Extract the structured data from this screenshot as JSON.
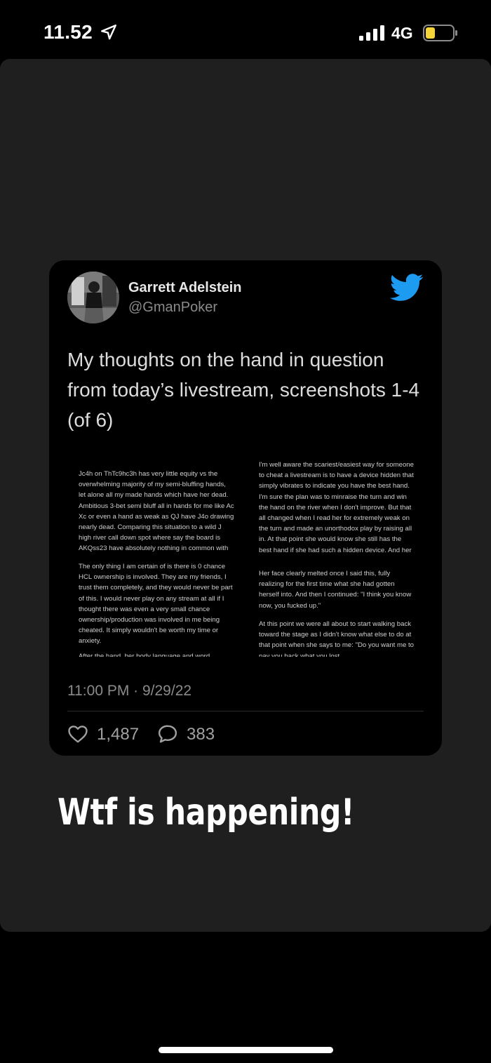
{
  "status_bar": {
    "time": "11.52",
    "network": "4G",
    "icons": [
      "location-arrow-icon",
      "signal-bars-icon",
      "battery-icon"
    ],
    "battery_color": "#f5d33a"
  },
  "tweet": {
    "author_name": "Garrett Adelstein",
    "author_handle": "@GmanPoker",
    "text": "My thoughts on the hand in question from today’s livestream, screenshots 1-4 (of 6)",
    "timestamp": "11:00 PM · 9/29/22",
    "likes": "1,487",
    "replies": "383",
    "brand_color": "#1d9bf0",
    "screenshots": {
      "left": [
        "Jc4h on ThTc9hc3h has very little equity vs the overwhelming majority of my semi-bluffing hands, let alone all my made hands which have her dead. Ambitious 3-bet semi bluff all in hands for me like Ac Xc or even a hand as weak as QJ have J4o drawing nearly dead. Comparing this situation to a wild J high river call down spot where say the board is AKQss23 have absolutely nothing in common with this",
        "The only thing I am certain of is there is 0 chance HCL ownership is involved. They are my friends, I trust them completely, and they would never be part of this. I would never play on any stream at all if I thought there was even a very small chance ownership/production was involved in me being cheated. It simply wouldn't be worth my time or anxiety.",
        "After the hand, her body language and word"
      ],
      "right": [
        "I'm well aware the scariest/easiest way for someone to cheat a livestream is to have a device hidden that simply vibrates to indicate you have the best hand. I'm sure the plan was to minraise the turn and win the hand on the river when I don't improve. But that all changed when I read her for extremely weak on the turn and made an unorthodox play by raising all in. At that point she would know she still has the best hand if she had such a hidden device. And her",
        "Her face clearly melted once I said this, fully realizing for the first time what she had gotten herself into. And then I continued: \"I think you know now, you fucked up.\"",
        "At this point we were all about to start walking back toward the stage as I didn't know what else to do at that point when she says to me: \"Do you want me to pay you back what you lost"
      ]
    }
  },
  "story_caption": "Wtf is happening!"
}
